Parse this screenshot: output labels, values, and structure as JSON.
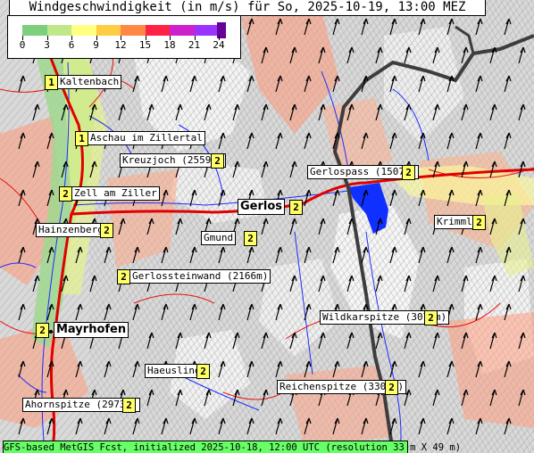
{
  "title": "Windgeschwindigkeit (in m/s) für So, 2025-10-19, 13:00 MEZ",
  "legend": {
    "ticks": [
      "0",
      "3",
      "6",
      "9",
      "12",
      "15",
      "18",
      "21",
      "24"
    ],
    "colors": [
      "#7dcf7d",
      "#bfe88a",
      "#ffff80",
      "#ffcc44",
      "#ff8844",
      "#ff2244",
      "#cc22cc",
      "#9933ff",
      "#660099"
    ]
  },
  "places": [
    {
      "name": "Kaltenbach",
      "value": "1"
    },
    {
      "name": "Aschau im Zillertal",
      "value": "1"
    },
    {
      "name": "Kreuzjoch (2559m)",
      "value": "2"
    },
    {
      "name": "Gerlospass (1507m)",
      "value": "2"
    },
    {
      "name": "Zell am Ziller",
      "value": "2"
    },
    {
      "name": "Gerlos",
      "value": "2"
    },
    {
      "name": "Krimml",
      "value": "2"
    },
    {
      "name": "Hainzenberg",
      "value": "2"
    },
    {
      "name": "Gmund",
      "value": "2"
    },
    {
      "name": "Gerlossteinwand (2166m)",
      "value": "2"
    },
    {
      "name": "Wildkarspitze (3076m)",
      "value": "2"
    },
    {
      "name": "Mayrhofen",
      "value": "2"
    },
    {
      "name": "Haeusling",
      "value": "2"
    },
    {
      "name": "Reichenspitze (3303m)",
      "value": "2"
    },
    {
      "name": "Ahornspitze (2973m)",
      "value": "2"
    }
  ],
  "wind": {
    "direction": "south-southwest",
    "arrow_color": "#000000"
  },
  "footer": "GFS-based MetGIS Fcst, initialized 2025-10-18, 12:00 UTC  (resolution 33 m X 49 m)"
}
